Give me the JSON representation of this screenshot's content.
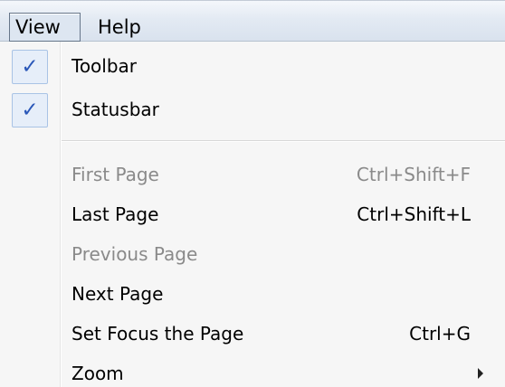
{
  "menubar": {
    "items": [
      {
        "label": "View"
      },
      {
        "label": "Help"
      }
    ]
  },
  "menu": {
    "check_glyph": "✓",
    "items": [
      {
        "label": "Toolbar",
        "checked": true
      },
      {
        "label": "Statusbar",
        "checked": true
      },
      {
        "label": "First Page",
        "shortcut": "Ctrl+Shift+F",
        "enabled": false
      },
      {
        "label": "Last Page",
        "shortcut": "Ctrl+Shift+L",
        "enabled": true
      },
      {
        "label": "Previous Page",
        "enabled": false
      },
      {
        "label": "Next Page",
        "enabled": true
      },
      {
        "label": "Set Focus the Page",
        "shortcut": "Ctrl+G",
        "enabled": true
      },
      {
        "label": "Zoom",
        "has_submenu": true,
        "enabled": true
      }
    ]
  },
  "colors": {
    "check": "#2a57b8",
    "disabled_text": "#8a8a8a",
    "menu_background": "#f6f6f6"
  },
  "icons": {
    "check": "checkmark-icon",
    "submenu": "submenu-arrow-icon"
  }
}
